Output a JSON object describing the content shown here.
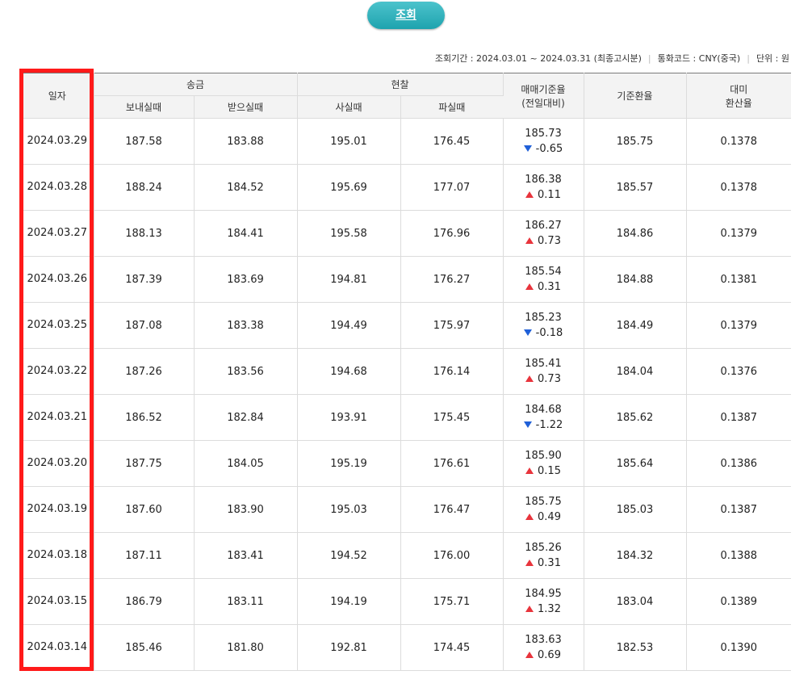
{
  "search_button": {
    "label": "조회"
  },
  "info": {
    "period_label": "조회기간 : 2024.03.01 ~ 2024.03.31 (최종고시분)",
    "currency_label": "통화코드 : CNY(중국)",
    "unit_label": "단위 : 원"
  },
  "table": {
    "headers": {
      "date": "일자",
      "remittance": "송금",
      "send": "보내실때",
      "receive": "받으실때",
      "cash": "현찰",
      "buy": "사실때",
      "sell": "파실때",
      "base_rate_line1": "매매기준율",
      "base_rate_line2": "(전일대비)",
      "standard_rate": "기준환율",
      "usd_line1": "대미",
      "usd_line2": "환산율"
    },
    "rows": [
      {
        "date": "2024.03.29",
        "send": "187.58",
        "receive": "183.88",
        "buy": "195.01",
        "sell": "176.45",
        "base": "185.73",
        "dir": "down",
        "change": "-0.65",
        "standard": "185.75",
        "usd": "0.1378"
      },
      {
        "date": "2024.03.28",
        "send": "188.24",
        "receive": "184.52",
        "buy": "195.69",
        "sell": "177.07",
        "base": "186.38",
        "dir": "up",
        "change": "0.11",
        "standard": "185.57",
        "usd": "0.1378"
      },
      {
        "date": "2024.03.27",
        "send": "188.13",
        "receive": "184.41",
        "buy": "195.58",
        "sell": "176.96",
        "base": "186.27",
        "dir": "up",
        "change": "0.73",
        "standard": "184.86",
        "usd": "0.1379"
      },
      {
        "date": "2024.03.26",
        "send": "187.39",
        "receive": "183.69",
        "buy": "194.81",
        "sell": "176.27",
        "base": "185.54",
        "dir": "up",
        "change": "0.31",
        "standard": "184.88",
        "usd": "0.1381"
      },
      {
        "date": "2024.03.25",
        "send": "187.08",
        "receive": "183.38",
        "buy": "194.49",
        "sell": "175.97",
        "base": "185.23",
        "dir": "down",
        "change": "-0.18",
        "standard": "184.49",
        "usd": "0.1379"
      },
      {
        "date": "2024.03.22",
        "send": "187.26",
        "receive": "183.56",
        "buy": "194.68",
        "sell": "176.14",
        "base": "185.41",
        "dir": "up",
        "change": "0.73",
        "standard": "184.04",
        "usd": "0.1376"
      },
      {
        "date": "2024.03.21",
        "send": "186.52",
        "receive": "182.84",
        "buy": "193.91",
        "sell": "175.45",
        "base": "184.68",
        "dir": "down",
        "change": "-1.22",
        "standard": "185.62",
        "usd": "0.1387"
      },
      {
        "date": "2024.03.20",
        "send": "187.75",
        "receive": "184.05",
        "buy": "195.19",
        "sell": "176.61",
        "base": "185.90",
        "dir": "up",
        "change": "0.15",
        "standard": "185.64",
        "usd": "0.1386"
      },
      {
        "date": "2024.03.19",
        "send": "187.60",
        "receive": "183.90",
        "buy": "195.03",
        "sell": "176.47",
        "base": "185.75",
        "dir": "up",
        "change": "0.49",
        "standard": "185.03",
        "usd": "0.1387"
      },
      {
        "date": "2024.03.18",
        "send": "187.11",
        "receive": "183.41",
        "buy": "194.52",
        "sell": "176.00",
        "base": "185.26",
        "dir": "up",
        "change": "0.31",
        "standard": "184.32",
        "usd": "0.1388"
      },
      {
        "date": "2024.03.15",
        "send": "186.79",
        "receive": "183.11",
        "buy": "194.19",
        "sell": "175.71",
        "base": "184.95",
        "dir": "up",
        "change": "1.32",
        "standard": "183.04",
        "usd": "0.1389"
      },
      {
        "date": "2024.03.14",
        "send": "185.46",
        "receive": "181.80",
        "buy": "192.81",
        "sell": "174.45",
        "base": "183.63",
        "dir": "up",
        "change": "0.69",
        "standard": "182.53",
        "usd": "0.1390"
      }
    ]
  },
  "colors": {
    "button": "#1ea3ae",
    "up": "#e8343c",
    "down": "#2060d8",
    "highlight": "#ff1a1a"
  }
}
